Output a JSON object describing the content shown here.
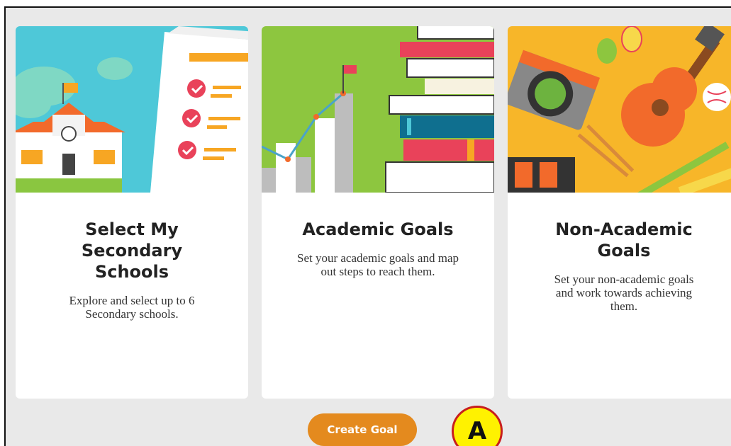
{
  "cards": [
    {
      "title": "Select My Secondary Schools",
      "description": "Explore and select up to 6 Secondary schools.",
      "image_icon": "school-checklist-illustration"
    },
    {
      "title": "Academic Goals",
      "description": "Set your academic goals and map out steps to reach them.",
      "image_icon": "books-chart-illustration"
    },
    {
      "title": "Non-Academic Goals",
      "description": "Set your non-academic goals and work towards achieving them.",
      "image_icon": "hobbies-illustration"
    }
  ],
  "actions": {
    "create_goal_label": "Create Goal"
  },
  "annotation": {
    "badge_label": "A"
  },
  "colors": {
    "button": "#e48a1e",
    "background": "#e9e9e9",
    "badge_fill": "#fff200",
    "badge_border": "#c81e1e"
  }
}
